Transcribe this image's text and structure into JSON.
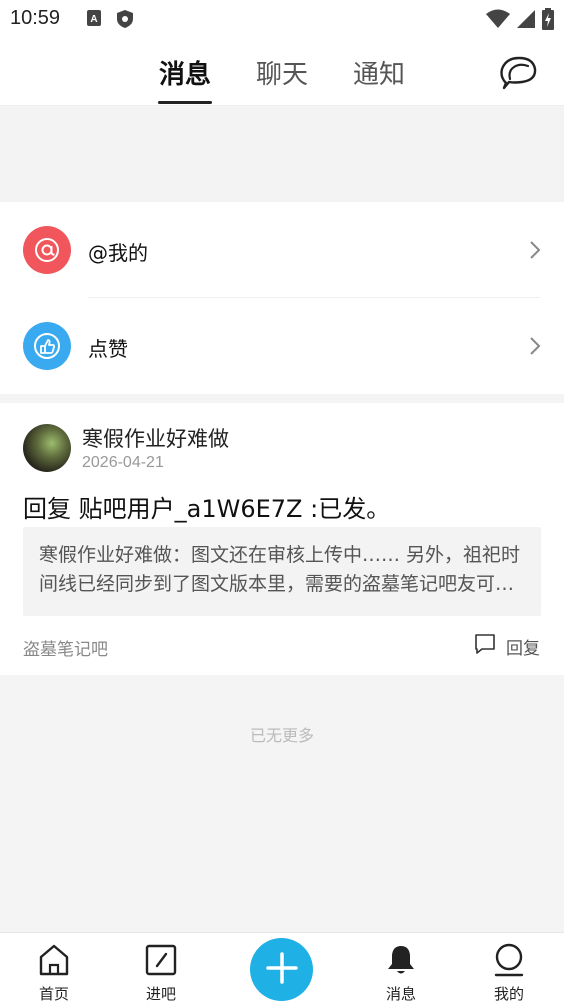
{
  "status_bar": {
    "time": "10:59",
    "left_icons": [
      "font-a-icon",
      "shield-icon"
    ],
    "right_icons": [
      "wifi-icon",
      "signal-icon",
      "battery-charging-icon"
    ]
  },
  "header": {
    "tabs": [
      {
        "label": "消息",
        "active": true
      },
      {
        "label": "聊天",
        "active": false
      },
      {
        "label": "通知",
        "active": false
      }
    ],
    "right_icon": "chat-bubbles-icon"
  },
  "entries": [
    {
      "label": "@我的",
      "icon": "at-icon",
      "color": "#f0565c"
    },
    {
      "label": "点赞",
      "icon": "thumbs-up-icon",
      "color": "#3aaaf0"
    }
  ],
  "post": {
    "author": "寒假作业好难做",
    "date": "2026-04-21",
    "reply_line": "回复  贴吧用户_a1W6E7Z :已发。",
    "quote": "寒假作业好难做：图文还在审核上传中…… 另外，祖祀时间线已经同步到了图文版本里，需要的盗墓笔记吧友可以去看看",
    "forum": "盗墓笔记吧",
    "reply_label": "回复"
  },
  "no_more_text": "已无更多",
  "bottom_nav": {
    "items": [
      {
        "label": "首页",
        "icon": "home-icon"
      },
      {
        "label": "进吧",
        "icon": "edit-square-icon"
      },
      {
        "label": "消息",
        "icon": "bell-icon"
      },
      {
        "label": "我的",
        "icon": "profile-icon"
      }
    ],
    "fab_icon": "plus-icon",
    "accent_color": "#1fb0e6"
  }
}
